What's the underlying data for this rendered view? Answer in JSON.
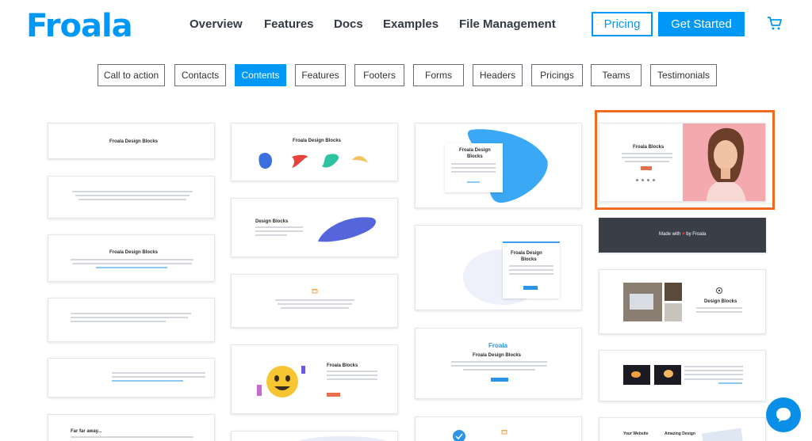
{
  "brand": {
    "logo_text": "Froala",
    "color": "#0098f7"
  },
  "nav": {
    "links": [
      "Overview",
      "Features",
      "Docs",
      "Examples",
      "File Management"
    ],
    "pricing_label": "Pricing",
    "get_started_label": "Get Started"
  },
  "tabs": [
    "Call to action",
    "Contacts",
    "Contents",
    "Features",
    "Footers",
    "Forms",
    "Headers",
    "Pricings",
    "Teams",
    "Testimonials"
  ],
  "active_tab": "Contents",
  "cards": {
    "design_blocks_1": "Froala Design Blocks",
    "design_blocks_2": "Froala Design Blocks",
    "design_blocks_3": "Froala Design Blocks",
    "design_blocks_4": "Froala Design Blocks",
    "design_blocks_5": "Froala Design Blocks",
    "design_blocks_plain": "Design Blocks",
    "design_blocks_plain_2": "Design Blocks",
    "design_blocks_stacked_1": "Froala Design",
    "design_blocks_stacked_2": "Blocks",
    "froala_blocks": "Froala Blocks",
    "froala_blocks_2": "Froala Blocks",
    "froala_small_logo": "Froala",
    "made_with_prefix": "Made with",
    "made_with_suffix": "by Froala",
    "far_far_away": "Far far away...",
    "your_website": "Your Website",
    "amazing_design": "Amazing Design",
    "learn_more": "Learn More"
  },
  "colors": {
    "selected_frame": "#f06a22",
    "active_tab": "#0098f7",
    "dark_card": "#3a3f47"
  }
}
